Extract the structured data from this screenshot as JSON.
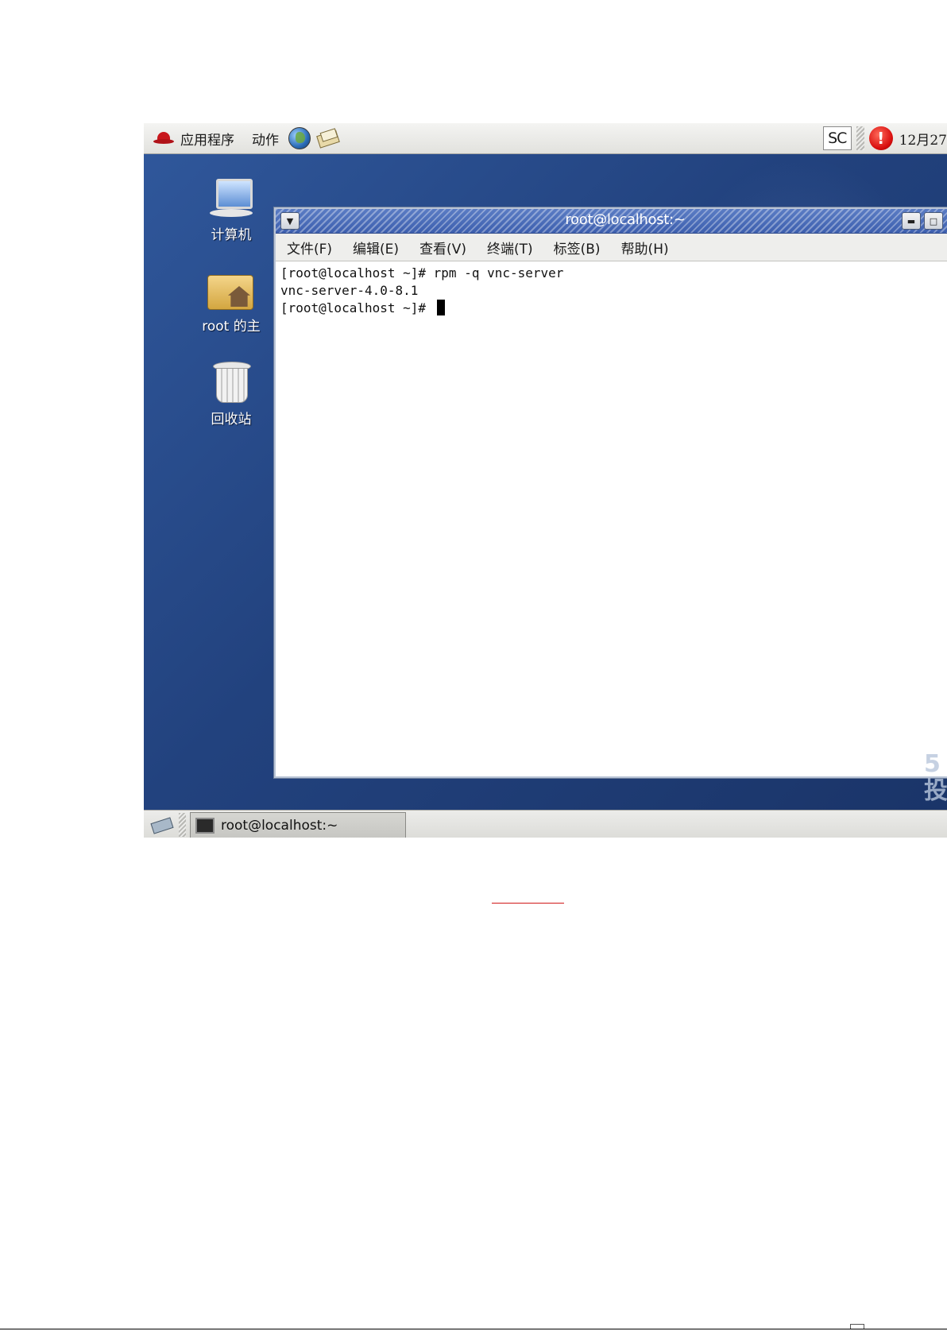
{
  "top_panel": {
    "menu_applications": "应用程序",
    "menu_actions": "动作",
    "input_method": "SC",
    "clock": "12月27"
  },
  "desktop_icons": [
    {
      "label": "计算机",
      "icon": "computer-icon"
    },
    {
      "label": "root 的主",
      "icon": "home-folder-icon"
    },
    {
      "label": "回收站",
      "icon": "trash-icon"
    }
  ],
  "terminal": {
    "title": "root@localhost:~",
    "menu": [
      {
        "label": "文件(F)"
      },
      {
        "label": "编辑(E)"
      },
      {
        "label": "查看(V)"
      },
      {
        "label": "终端(T)"
      },
      {
        "label": "标签(B)"
      },
      {
        "label": "帮助(H)"
      }
    ],
    "lines": [
      "[root@localhost ~]# rpm -q vnc-server",
      "vnc-server-4.0-8.1",
      "[root@localhost ~]# "
    ]
  },
  "bottom_panel": {
    "task_label": "root@localhost:~"
  },
  "colors": {
    "desktop_blue": "#22427e",
    "title_bar_blue": "#3d5fae",
    "alert_red": "#d80d0d",
    "underline_red": "#d01818"
  }
}
